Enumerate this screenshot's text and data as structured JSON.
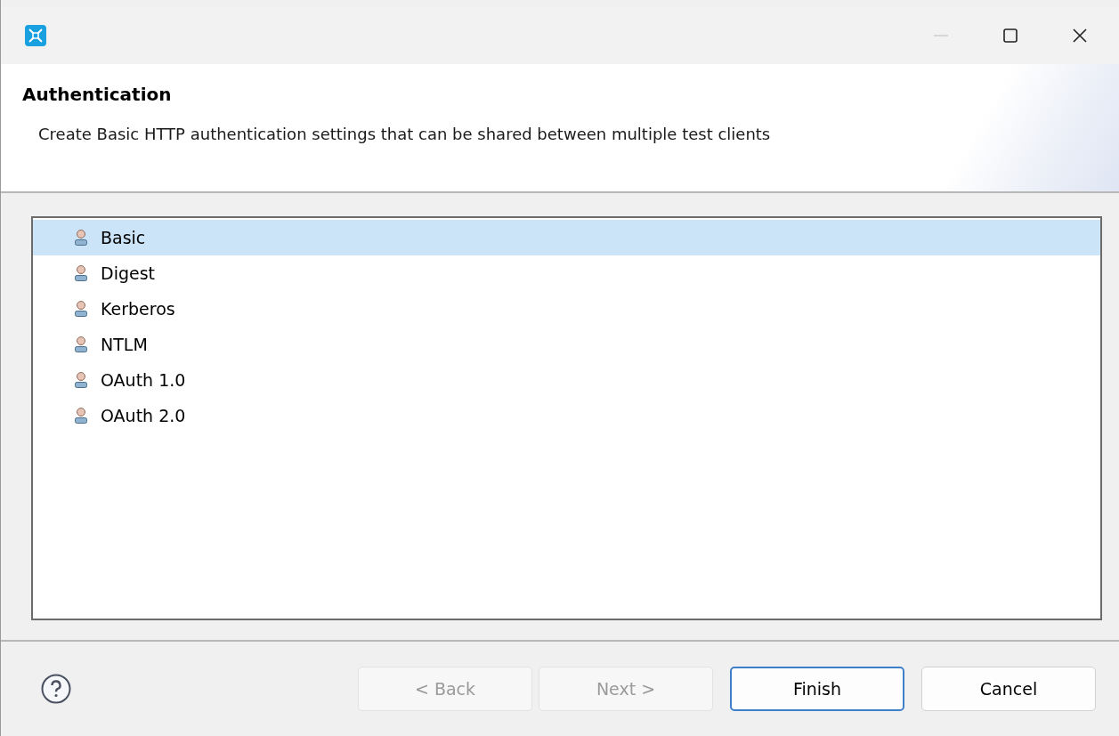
{
  "header": {
    "title": "Authentication",
    "description": "Create Basic HTTP authentication settings that can be shared between multiple test clients"
  },
  "items": [
    {
      "label": "Basic",
      "selected": true
    },
    {
      "label": "Digest",
      "selected": false
    },
    {
      "label": "Kerberos",
      "selected": false
    },
    {
      "label": "NTLM",
      "selected": false
    },
    {
      "label": "OAuth 1.0",
      "selected": false
    },
    {
      "label": "OAuth 2.0",
      "selected": false
    }
  ],
  "buttons": [
    {
      "label": "< Back",
      "disabled": true,
      "default": false
    },
    {
      "label": "Next >",
      "disabled": true,
      "default": false
    },
    {
      "label": "Finish",
      "disabled": false,
      "default": true
    },
    {
      "label": "Cancel",
      "disabled": false,
      "default": false
    }
  ]
}
